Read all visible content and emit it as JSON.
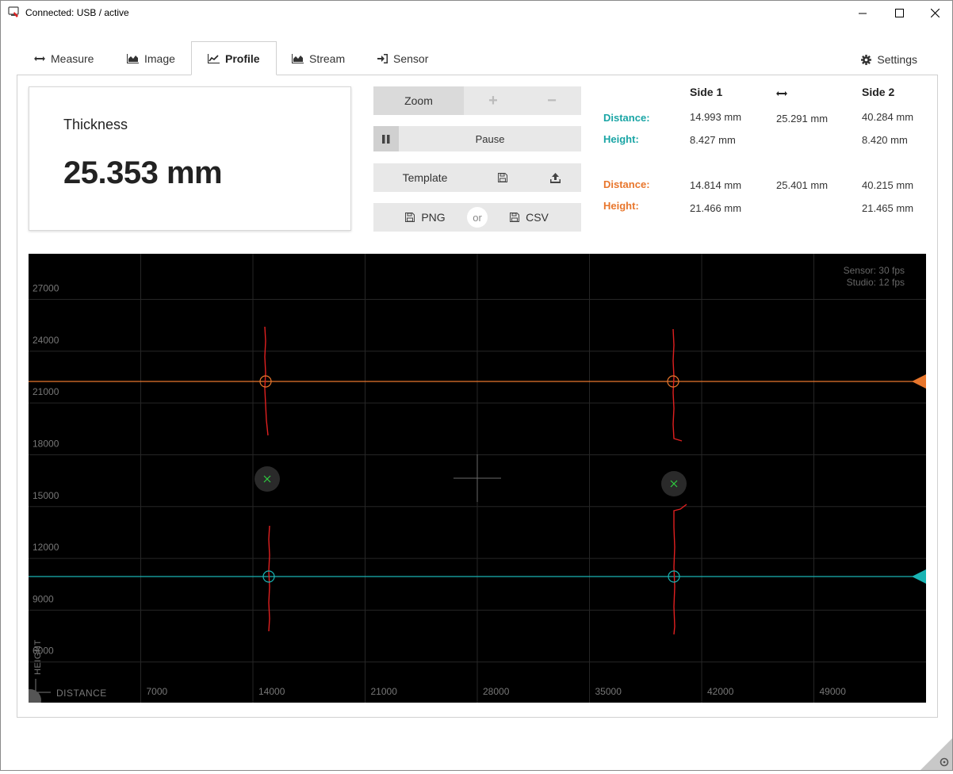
{
  "window": {
    "title": "Connected: USB / active"
  },
  "tabs": [
    {
      "label": "Measure",
      "icon": "arrows-horizontal-icon"
    },
    {
      "label": "Image",
      "icon": "area-chart-icon"
    },
    {
      "label": "Profile",
      "icon": "line-chart-icon",
      "active": true
    },
    {
      "label": "Stream",
      "icon": "area-chart-icon"
    },
    {
      "label": "Sensor",
      "icon": "sign-in-icon"
    }
  ],
  "settings": {
    "label": "Settings"
  },
  "thickness": {
    "label": "Thickness",
    "value": "25.353 mm"
  },
  "controls": {
    "zoom_label": "Zoom",
    "zoom_plus": "+",
    "zoom_minus": "−",
    "pause_label": "Pause",
    "template_label": "Template",
    "png_label": "PNG",
    "or_label": "or",
    "csv_label": "CSV"
  },
  "measurements": {
    "side1_header": "Side 1",
    "side2_header": "Side 2",
    "teal": {
      "distance_label": "Distance:",
      "height_label": "Height:",
      "distance_side1": "14.993 mm",
      "distance_between": "25.291 mm",
      "distance_side2": "40.284 mm",
      "height_side1": "8.427 mm",
      "height_side2": "8.420 mm"
    },
    "orange": {
      "distance_label": "Distance:",
      "height_label": "Height:",
      "distance_side1": "14.814 mm",
      "distance_between": "25.401 mm",
      "distance_side2": "40.215 mm",
      "height_side1": "21.466 mm",
      "height_side2": "21.465 mm"
    }
  },
  "plot": {
    "sensor_fps": "Sensor: 30 fps",
    "studio_fps": "Studio: 12 fps",
    "height_axis_label": "HEIGHT",
    "distance_axis_label": "DISTANCE",
    "y_ticks": [
      "27000",
      "24000",
      "21000",
      "18000",
      "15000",
      "12000",
      "9000",
      "6000"
    ],
    "x_ticks": [
      "7000",
      "14000",
      "21000",
      "28000",
      "35000",
      "42000",
      "49000"
    ],
    "colors": {
      "background": "#000000",
      "grid": "#262626",
      "teal": "#19b4b4",
      "orange": "#e8762c",
      "profile": "#e02020",
      "marker": "#2ecc40"
    }
  },
  "chart_data": {
    "type": "scatter",
    "xlabel": "DISTANCE",
    "ylabel": "HEIGHT",
    "xlim": [
      0,
      56000
    ],
    "ylim": [
      3000,
      29000
    ],
    "series": [
      {
        "name": "",
        "x": [
          14800,
          14800,
          14900,
          15000,
          15000
        ],
        "y": [
          24500,
          21400,
          17500,
          12200,
          5000
        ]
      },
      {
        "name": "",
        "x": [
          40200,
          40250,
          40300,
          40200,
          40300
        ],
        "y": [
          24300,
          21400,
          17200,
          12000,
          4800
        ]
      }
    ],
    "reference_lines": [
      {
        "y": 21466
      },
      {
        "y": 8427
      }
    ]
  }
}
